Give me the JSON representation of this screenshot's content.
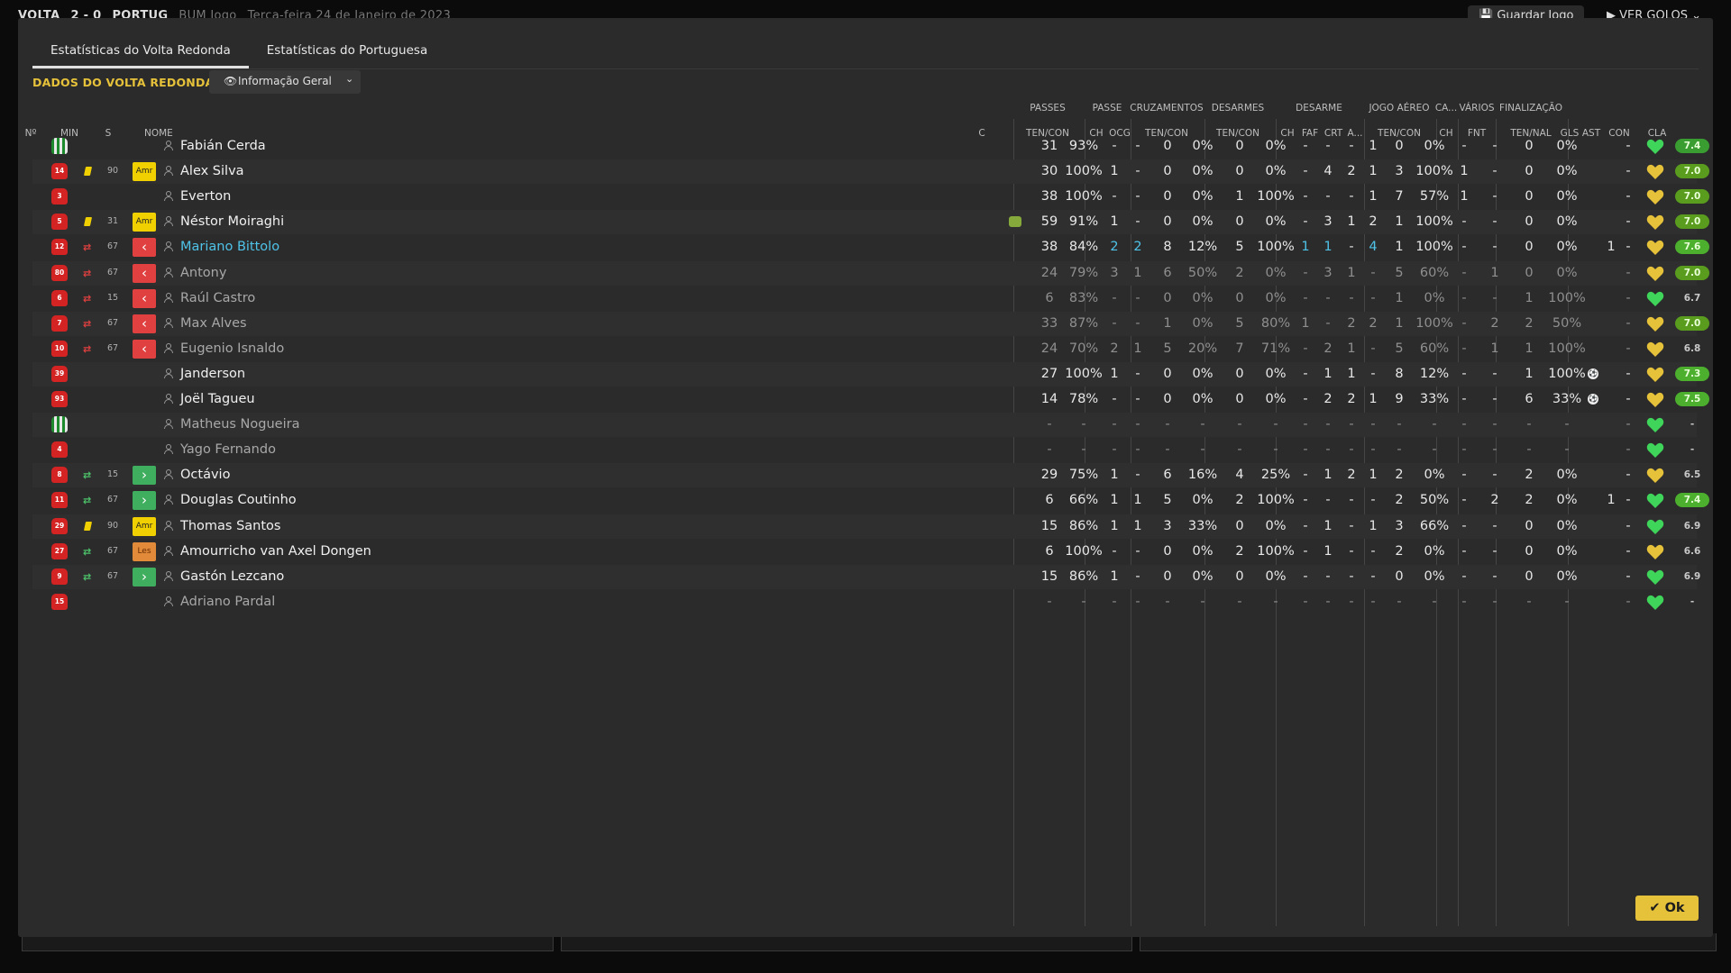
{
  "topbar": {
    "home_team": "VOLTA",
    "score": "2 - 0",
    "away_team": "PORTUG",
    "venue": "BUM Jogo",
    "date": "Terça-feira 24 de Janeiro de 2023",
    "save_label": "Guardar Jogo",
    "goals_label": "VER GOLOS"
  },
  "tabs": [
    "Estatísticas do Volta Redonda",
    "Estatísticas do Portuguesa"
  ],
  "section_title": "DADOS DO VOLTA REDONDA",
  "view_select": {
    "label": "Informação Geral"
  },
  "group_headers": [
    "PASSES",
    "PASSE",
    "CRUZAMENTOS",
    "DESARMES",
    "DESARME",
    "JOGO AÉREO",
    "CA...",
    "VÁRIOS",
    "FINALIZAÇÃO"
  ],
  "column_headers": [
    "Nº",
    "MIN",
    "S",
    "NOME",
    "C",
    "TEN/CON",
    "CH",
    "OCG",
    "TEN/CON",
    "TEN/CON",
    "CH",
    "FAF",
    "CRT",
    "A...",
    "TEN/CON",
    "CH",
    "FNT",
    "TEN/NAL",
    "GLS",
    "AST",
    "CON",
    "CLA"
  ],
  "players": [
    {
      "num": "",
      "gk": true,
      "name": "Fabián Cerda",
      "style": "normal",
      "stats": [
        "31",
        "93%",
        "-",
        "-",
        "0",
        "0%",
        "0",
        "0%",
        "-",
        "-",
        "-",
        "1",
        "0",
        "0%",
        "-",
        "-",
        "0",
        "0%",
        "",
        "-"
      ],
      "con": "green",
      "rating": "7.4",
      "rcolor": "#3a9d32"
    },
    {
      "num": "14",
      "card": true,
      "min": "90",
      "sbox": "amr",
      "sbox_label": "Amr",
      "name": "Alex Silva",
      "style": "normal",
      "stats": [
        "30",
        "100%",
        "1",
        "-",
        "0",
        "0%",
        "0",
        "0%",
        "-",
        "4",
        "2",
        "1",
        "3",
        "100%",
        "1",
        "-",
        "0",
        "0%",
        "",
        "-"
      ],
      "con": "orange",
      "rating": "7.0",
      "rcolor": "#5a9d1e"
    },
    {
      "num": "3",
      "name": "Everton",
      "style": "normal",
      "stats": [
        "38",
        "100%",
        "-",
        "-",
        "0",
        "0%",
        "1",
        "100%",
        "-",
        "-",
        "-",
        "1",
        "7",
        "57%",
        "1",
        "-",
        "0",
        "0%",
        "",
        "-"
      ],
      "con": "yellow",
      "rating": "7.0",
      "rcolor": "#5a9d1e"
    },
    {
      "num": "5",
      "card": true,
      "min": "31",
      "sbox": "amr",
      "sbox_label": "Amr",
      "name": "Néstor Moiraghi",
      "style": "normal",
      "fit": true,
      "stats": [
        "59",
        "91%",
        "1",
        "-",
        "0",
        "0%",
        "0",
        "0%",
        "-",
        "3",
        "1",
        "2",
        "1",
        "100%",
        "-",
        "-",
        "0",
        "0%",
        "",
        "-"
      ],
      "con": "yellow",
      "rating": "7.0",
      "rcolor": "#5a9d1e"
    },
    {
      "num": "12",
      "sub": "out",
      "min": "67",
      "sbox": "out",
      "name": "Mariano Bittolo",
      "style": "teal",
      "stats": [
        "38",
        "84%",
        "2",
        "2",
        "8",
        "12%",
        "5",
        "100%",
        "1",
        "1",
        "-",
        "4",
        "1",
        "100%",
        "-",
        "-",
        "0",
        "0%",
        "1",
        "-"
      ],
      "con": "yellow",
      "rating": "7.6",
      "rcolor": "#4caf2e",
      "teal_stats": [
        2,
        3,
        8,
        9,
        11
      ]
    },
    {
      "num": "80",
      "sub": "out",
      "min": "67",
      "sbox": "out",
      "name": "Antony",
      "style": "grey",
      "stats": [
        "24",
        "79%",
        "3",
        "1",
        "6",
        "50%",
        "2",
        "0%",
        "-",
        "3",
        "1",
        "-",
        "5",
        "60%",
        "-",
        "1",
        "0",
        "0%",
        "",
        "-"
      ],
      "con": "yellow",
      "rating": "7.0",
      "rcolor": "#5a9d1e"
    },
    {
      "num": "6",
      "sub": "out",
      "min": "15",
      "sbox": "out",
      "name": "Raúl Castro",
      "style": "grey",
      "stats": [
        "6",
        "83%",
        "-",
        "-",
        "0",
        "0%",
        "0",
        "0%",
        "-",
        "-",
        "-",
        "-",
        "1",
        "0%",
        "-",
        "-",
        "1",
        "100%",
        "",
        "-"
      ],
      "con": "green",
      "rating": "6.7",
      "rcolor": ""
    },
    {
      "num": "7",
      "sub": "out",
      "min": "67",
      "sbox": "out",
      "name": "Max Alves",
      "style": "grey",
      "stats": [
        "33",
        "87%",
        "-",
        "-",
        "1",
        "0%",
        "5",
        "80%",
        "1",
        "-",
        "2",
        "2",
        "1",
        "100%",
        "-",
        "2",
        "2",
        "50%",
        "",
        "-"
      ],
      "con": "yellow",
      "rating": "7.0",
      "rcolor": "#5a9d1e"
    },
    {
      "num": "10",
      "sub": "out",
      "min": "67",
      "sbox": "out",
      "name": "Eugenio Isnaldo",
      "style": "grey",
      "stats": [
        "24",
        "70%",
        "2",
        "1",
        "5",
        "20%",
        "7",
        "71%",
        "-",
        "2",
        "1",
        "-",
        "5",
        "60%",
        "-",
        "1",
        "1",
        "100%",
        "",
        "-"
      ],
      "con": "orange",
      "rating": "6.8",
      "rcolor": ""
    },
    {
      "num": "39",
      "name": "Janderson",
      "style": "normal",
      "ball": true,
      "stats": [
        "27",
        "100%",
        "1",
        "-",
        "0",
        "0%",
        "0",
        "0%",
        "-",
        "1",
        "1",
        "-",
        "8",
        "12%",
        "-",
        "-",
        "1",
        "100%",
        "",
        "-"
      ],
      "con": "orange",
      "rating": "7.3",
      "rcolor": "#4caf2e"
    },
    {
      "num": "93",
      "name": "Joël Tagueu",
      "style": "normal",
      "ball": true,
      "stats": [
        "14",
        "78%",
        "-",
        "-",
        "0",
        "0%",
        "0",
        "0%",
        "-",
        "2",
        "2",
        "1",
        "9",
        "33%",
        "-",
        "-",
        "6",
        "33%",
        "",
        "-"
      ],
      "con": "orange",
      "rating": "7.5",
      "rcolor": "#4caf2e"
    },
    {
      "num": "",
      "gk": true,
      "name": "Matheus Nogueira",
      "style": "grey",
      "stats": [
        "-",
        "-",
        "-",
        "-",
        "-",
        "-",
        "-",
        "-",
        "-",
        "-",
        "-",
        "-",
        "-",
        "-",
        "-",
        "-",
        "-",
        "-",
        "",
        "-"
      ],
      "con": "green",
      "rating": "-",
      "rcolor": ""
    },
    {
      "num": "4",
      "name": "Yago Fernando",
      "style": "grey",
      "stats": [
        "-",
        "-",
        "-",
        "-",
        "-",
        "-",
        "-",
        "-",
        "-",
        "-",
        "-",
        "-",
        "-",
        "-",
        "-",
        "-",
        "-",
        "-",
        "",
        "-"
      ],
      "con": "green",
      "rating": "-",
      "rcolor": ""
    },
    {
      "num": "8",
      "sub": "in",
      "min": "15",
      "sbox": "in",
      "name": "Octávio",
      "style": "normal",
      "stats": [
        "29",
        "75%",
        "1",
        "-",
        "6",
        "16%",
        "4",
        "25%",
        "-",
        "1",
        "2",
        "1",
        "2",
        "0%",
        "-",
        "-",
        "2",
        "0%",
        "",
        "-"
      ],
      "con": "orange",
      "rating": "6.5",
      "rcolor": ""
    },
    {
      "num": "11",
      "sub": "in",
      "min": "67",
      "sbox": "in",
      "name": "Douglas Coutinho",
      "style": "normal",
      "stats": [
        "6",
        "66%",
        "1",
        "1",
        "5",
        "0%",
        "2",
        "100%",
        "-",
        "-",
        "-",
        "-",
        "2",
        "50%",
        "-",
        "2",
        "2",
        "0%",
        "1",
        "-"
      ],
      "con": "green",
      "rating": "7.4",
      "rcolor": "#4caf2e"
    },
    {
      "num": "29",
      "card": true,
      "min": "90",
      "sbox": "amr",
      "sbox_label": "Amr",
      "name": "Thomas Santos",
      "style": "normal",
      "stats": [
        "15",
        "86%",
        "1",
        "1",
        "3",
        "33%",
        "0",
        "0%",
        "-",
        "1",
        "-",
        "1",
        "3",
        "66%",
        "-",
        "-",
        "0",
        "0%",
        "",
        "-"
      ],
      "con": "green",
      "rating": "6.9",
      "rcolor": ""
    },
    {
      "num": "27",
      "sub": "in",
      "min": "67",
      "sbox": "les",
      "sbox_label": "Les",
      "name": "Amourricho van Axel Dongen",
      "style": "normal",
      "stats": [
        "6",
        "100%",
        "-",
        "-",
        "0",
        "0%",
        "2",
        "100%",
        "-",
        "1",
        "-",
        "-",
        "2",
        "0%",
        "-",
        "-",
        "0",
        "0%",
        "",
        "-"
      ],
      "con": "yellow",
      "rating": "6.6",
      "rcolor": ""
    },
    {
      "num": "9",
      "sub": "in",
      "min": "67",
      "sbox": "in",
      "name": "Gastón Lezcano",
      "style": "normal",
      "stats": [
        "15",
        "86%",
        "1",
        "-",
        "0",
        "0%",
        "0",
        "0%",
        "-",
        "-",
        "-",
        "-",
        "0",
        "0%",
        "-",
        "-",
        "0",
        "0%",
        "",
        "-"
      ],
      "con": "green",
      "rating": "6.9",
      "rcolor": ""
    },
    {
      "num": "15",
      "name": "Adriano Pardal",
      "style": "grey",
      "stats": [
        "-",
        "-",
        "-",
        "-",
        "-",
        "-",
        "-",
        "-",
        "-",
        "-",
        "-",
        "-",
        "-",
        "-",
        "-",
        "-",
        "-",
        "-",
        "",
        "-"
      ],
      "con": "green",
      "rating": "-",
      "rcolor": ""
    }
  ],
  "ok_label": "Ok",
  "colors": {
    "accent": "#e6c23a",
    "modal_bg": "#2b2b2b",
    "teal": "#4fc3e8"
  }
}
